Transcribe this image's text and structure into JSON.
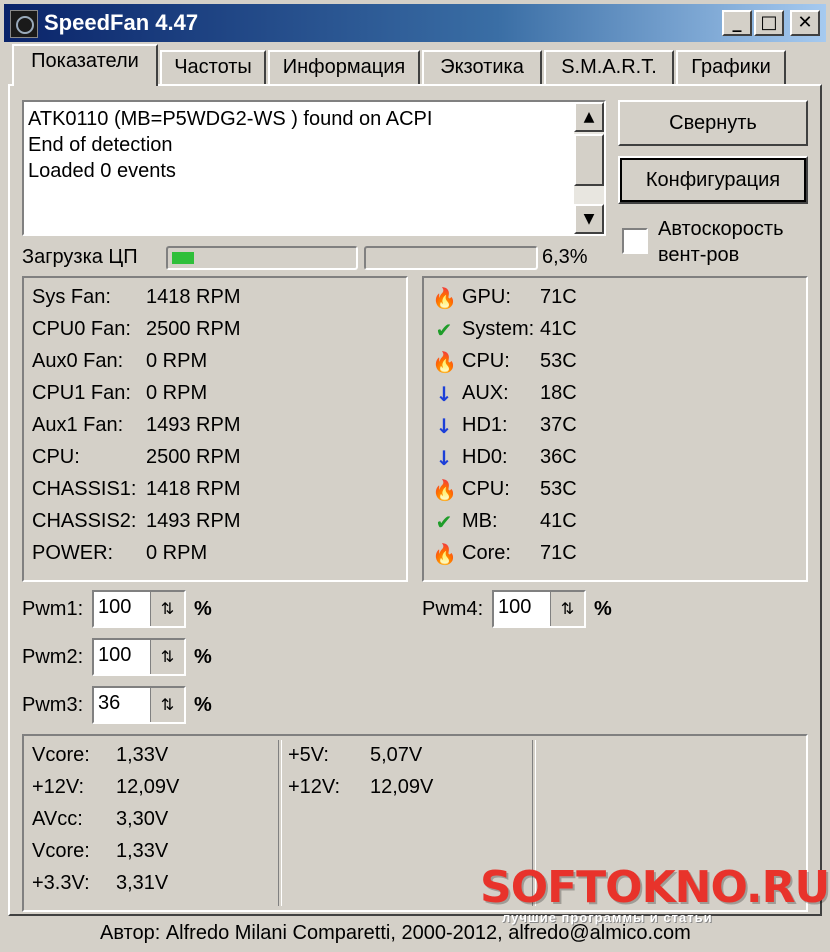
{
  "window": {
    "title": "SpeedFan 4.47",
    "controls": {
      "minimize": "_",
      "maximize": "□",
      "close": "✕"
    }
  },
  "tabs": [
    {
      "label": "Показатели",
      "active": true
    },
    {
      "label": "Частоты",
      "active": false
    },
    {
      "label": "Информация",
      "active": false
    },
    {
      "label": "Экзотика",
      "active": false
    },
    {
      "label": "S.M.A.R.T.",
      "active": false
    },
    {
      "label": "Графики",
      "active": false
    }
  ],
  "log": {
    "lines": [
      "ATK0110 (MB=P5WDG2-WS    ) found on ACPI",
      "End of detection",
      "Loaded 0 events"
    ]
  },
  "buttons": {
    "minimize": "Свернуть",
    "configure": "Конфигурация"
  },
  "auto_speed": {
    "label": "Автоскорость вент-ров",
    "checked": false
  },
  "cpu": {
    "label": "Загрузка ЦП",
    "value": "6,3%",
    "core1_fraction": 0.12,
    "core2_fraction": 0.0
  },
  "fans": [
    {
      "name": "Sys Fan:",
      "value": "1418 RPM"
    },
    {
      "name": "CPU0 Fan:",
      "value": "2500 RPM"
    },
    {
      "name": "Aux0 Fan:",
      "value": "0 RPM"
    },
    {
      "name": "CPU1 Fan:",
      "value": "0 RPM"
    },
    {
      "name": "Aux1 Fan:",
      "value": "1493 RPM"
    },
    {
      "name": "CPU:",
      "value": "2500 RPM"
    },
    {
      "name": "CHASSIS1:",
      "value": "1418 RPM"
    },
    {
      "name": "CHASSIS2:",
      "value": "1493 RPM"
    },
    {
      "name": "POWER:",
      "value": "0 RPM"
    }
  ],
  "temps": [
    {
      "icon": "flame-icon",
      "name": "GPU:",
      "value": "71C"
    },
    {
      "icon": "checkmark-icon",
      "name": "System:",
      "value": "41C"
    },
    {
      "icon": "flame-icon",
      "name": "CPU:",
      "value": "53C"
    },
    {
      "icon": "down-arrow-icon",
      "name": "AUX:",
      "value": "18C"
    },
    {
      "icon": "down-arrow-icon",
      "name": "HD1:",
      "value": "37C"
    },
    {
      "icon": "down-arrow-icon",
      "name": "HD0:",
      "value": "36C"
    },
    {
      "icon": "flame-icon",
      "name": "CPU:",
      "value": "53C"
    },
    {
      "icon": "checkmark-icon",
      "name": "MB:",
      "value": "41C"
    },
    {
      "icon": "flame-icon",
      "name": "Core:",
      "value": "71C"
    }
  ],
  "icon_colors": {
    "flame": "#e8331c",
    "checkmark": "#1f9d2a",
    "arrow": "#1c3fd8"
  },
  "pwm": [
    {
      "label": "Pwm1:",
      "value": "100",
      "unit": "%"
    },
    {
      "label": "Pwm2:",
      "value": "100",
      "unit": "%"
    },
    {
      "label": "Pwm3:",
      "value": "36",
      "unit": "%"
    },
    {
      "label": "Pwm4:",
      "value": "100",
      "unit": "%"
    }
  ],
  "voltages_left": [
    {
      "name": "Vcore:",
      "value": "1,33V"
    },
    {
      "name": "+12V:",
      "value": "12,09V"
    },
    {
      "name": "AVcc:",
      "value": "3,30V"
    },
    {
      "name": "Vcore:",
      "value": "1,33V"
    },
    {
      "name": "+3.3V:",
      "value": "3,31V"
    }
  ],
  "voltages_mid": [
    {
      "name": "+5V:",
      "value": "5,07V"
    },
    {
      "name": "+12V:",
      "value": "12,09V"
    }
  ],
  "footer": "Автор: Alfredo Milani Comparetti, 2000-2012, alfredo@almico.com",
  "watermark": {
    "text": "SOFTOKNO.RU",
    "sub": "лучшие программы и статьи"
  }
}
